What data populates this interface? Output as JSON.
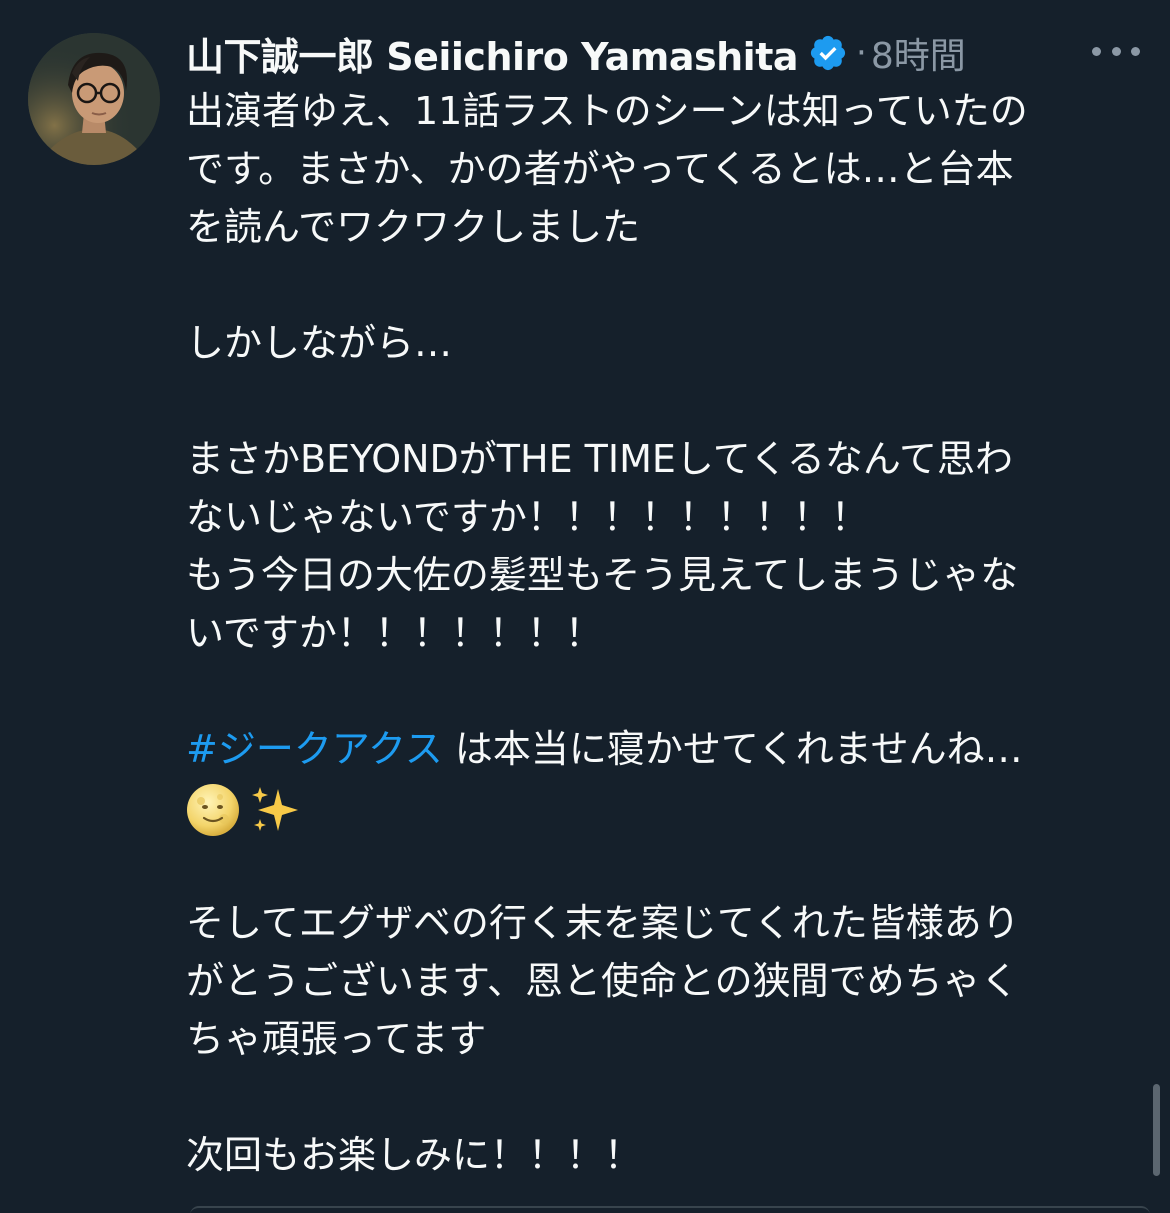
{
  "tweet": {
    "author_name": "山下誠一郎 Seiichiro Yamashita",
    "verified_icon": "verified-badge-icon",
    "separator": "·",
    "timestamp": "8時間",
    "more_icon": "more-options-icon",
    "body_lines": {
      "l1": "出演者ゆえ、11話ラストのシーンは知っていたの",
      "l2": "です。まさか、かの者がやってくるとは…と台本",
      "l3": "を読んでワクワクしました",
      "l4": "しかしながら…",
      "l5": "まさかBEYONDがTHE TIMEしてくるなんて思わ",
      "l6": "ないじゃないですか！！！！！！！！！",
      "l7": "もう今日の大佐の髪型もそう見えてしまうじゃな",
      "l8": "いですか！！！！！！！",
      "l9_hashtag": "#ジークアクス",
      "l9_rest": " は本当に寝かせてくれませんね…",
      "l10_emoji1": "full-moon-face-emoji",
      "l10_emoji2": "sparkles-emoji",
      "l11": "そしてエグザベの行く末を案じてくれた皆様あり",
      "l12": "がとうございます、恩と使命との狭間でめちゃく",
      "l13": "ちゃ頑張ってます",
      "l14": "次回もお楽しみに！！！！"
    }
  },
  "colors": {
    "background": "#15202b",
    "text": "#f7f9f9",
    "secondary": "#8b98a5",
    "link": "#1d9bf0",
    "verified": "#1d9bf0"
  }
}
